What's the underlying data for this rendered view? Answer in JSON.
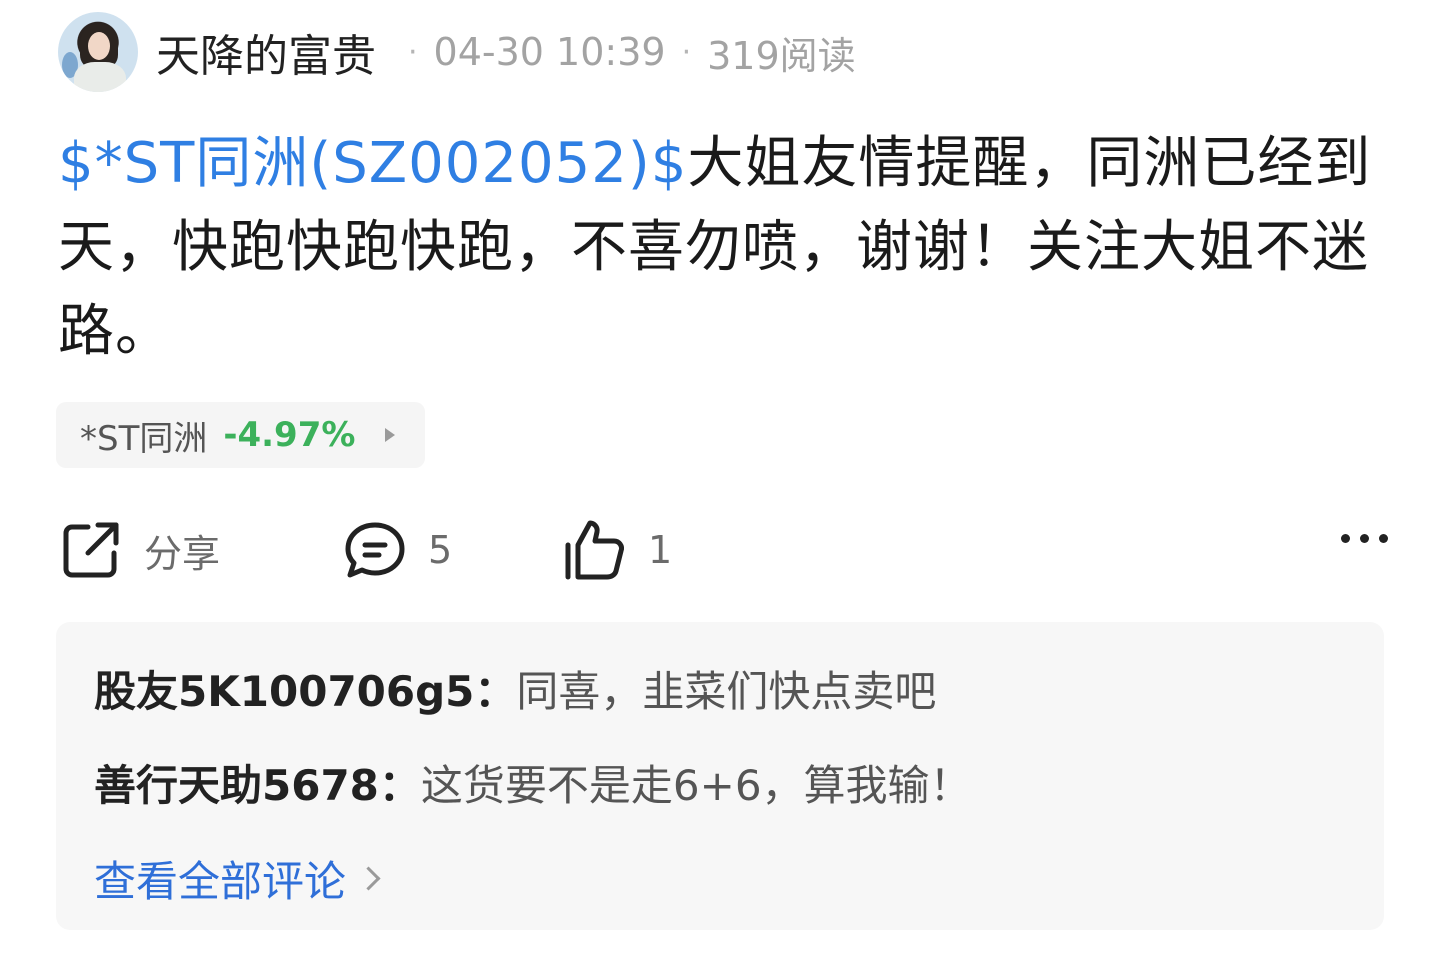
{
  "post": {
    "author": "天降的富贵",
    "time": "04-30 10:39",
    "views": "319阅读",
    "content": {
      "stock_link": "$*ST同洲(SZ002052)$",
      "text": "大姐友情提醒，同洲已经到天，快跑快跑快跑，不喜勿喷，谢谢！关注大姐不迷路。"
    },
    "stock_chip": {
      "name": "*ST同洲",
      "change": "-4.97%"
    },
    "actions": {
      "share_label": "分享",
      "comment_count": "5",
      "like_count": "1"
    },
    "comments": [
      {
        "user": "股友5K100706g5：",
        "text": "同喜，韭菜们快点卖吧"
      },
      {
        "user": "善行天助5678：",
        "text": "这货要不是走6+6，算我输！"
      }
    ],
    "view_all_label": "查看全部评论"
  },
  "colors": {
    "link_blue": "#2f7fe3",
    "down_green": "#3cb15b",
    "view_all_blue": "#2f6fd8"
  },
  "icons": [
    "avatar-image",
    "share-icon",
    "comment-icon",
    "like-icon",
    "more-icon",
    "chevron-right-icon"
  ]
}
